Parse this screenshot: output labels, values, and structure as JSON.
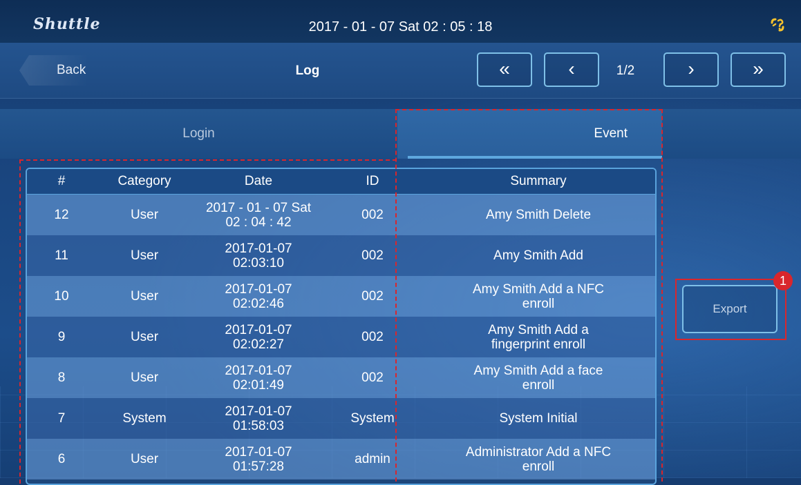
{
  "header": {
    "logo": "Shuttle",
    "datetime": "2017 - 01 - 07  Sat  02 : 05 : 18",
    "connection_icon": "link-broken-icon"
  },
  "nav": {
    "back_label": "Back",
    "title": "Log",
    "first_label": "«",
    "prev_label": "‹",
    "page_indicator": "1/2",
    "next_label": "›",
    "last_label": "»"
  },
  "tabs": {
    "login": "Login",
    "event": "Event"
  },
  "table": {
    "columns": [
      "#",
      "Category",
      "Date",
      "ID",
      "Summary"
    ],
    "rows": [
      {
        "num": "12",
        "category": "User",
        "date_line1": "2017 - 01 - 07  Sat",
        "date_line2": "02 : 04 : 42",
        "id": "002",
        "summary_line1": "Amy Smith Delete",
        "summary_line2": ""
      },
      {
        "num": "11",
        "category": "User",
        "date_line1": "2017-01-07",
        "date_line2": "02:03:10",
        "id": "002",
        "summary_line1": "Amy Smith Add",
        "summary_line2": ""
      },
      {
        "num": "10",
        "category": "User",
        "date_line1": "2017-01-07",
        "date_line2": "02:02:46",
        "id": "002",
        "summary_line1": "Amy Smith Add a NFC",
        "summary_line2": "enroll"
      },
      {
        "num": "9",
        "category": "User",
        "date_line1": "2017-01-07",
        "date_line2": "02:02:27",
        "id": "002",
        "summary_line1": "Amy Smith Add a",
        "summary_line2": "fingerprint enroll"
      },
      {
        "num": "8",
        "category": "User",
        "date_line1": "2017-01-07",
        "date_line2": "02:01:49",
        "id": "002",
        "summary_line1": "Amy Smith Add a face",
        "summary_line2": "enroll"
      },
      {
        "num": "7",
        "category": "System",
        "date_line1": "2017-01-07",
        "date_line2": "01:58:03",
        "id": "System",
        "summary_line1": "System Initial",
        "summary_line2": ""
      },
      {
        "num": "6",
        "category": "User",
        "date_line1": "2017-01-07",
        "date_line2": "01:57:28",
        "id": "admin",
        "summary_line1": "Administrator Add a NFC",
        "summary_line2": "enroll"
      }
    ]
  },
  "actions": {
    "export_label": "Export"
  },
  "annotation": {
    "badge": "1",
    "highlight_color": "#d9262c"
  },
  "colors": {
    "accent_border": "#7fc0e8",
    "header_bg": "#0e2d55",
    "row_light": "#6ea0dc",
    "row_dark": "#3764a5"
  }
}
